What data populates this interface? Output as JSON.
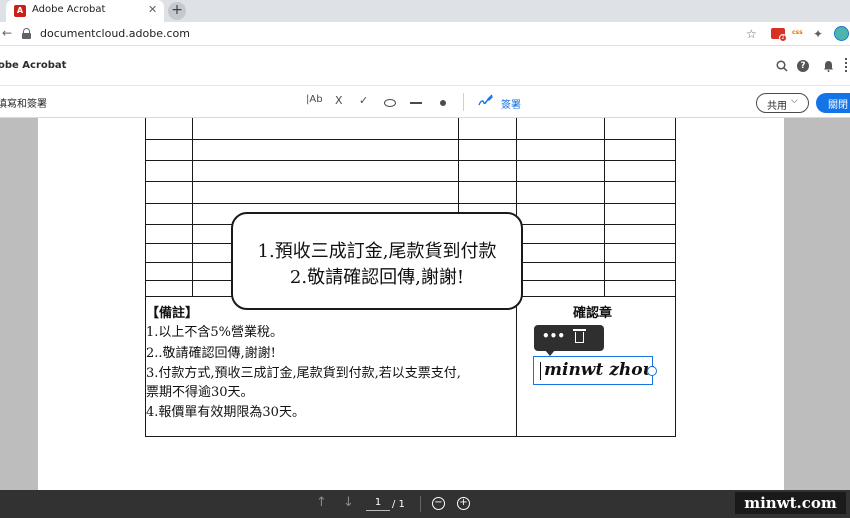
{
  "browser": {
    "tab_title": "Adobe Acrobat",
    "tab_favicon": "A",
    "tab_close": "✕",
    "new_tab": "+",
    "back": "←",
    "url": "documentcloud.adobe.com",
    "ext_badge": "2",
    "ext_css": "css"
  },
  "app": {
    "title": "obe Acrobat"
  },
  "toolbar": {
    "title": "填寫和簽署",
    "text_tool": "|Ab",
    "cross_tool": "X",
    "check_tool": "✓",
    "sign_label": "簽署",
    "share_label": "共用",
    "share_chevron": "⌵",
    "close_label": "關閉"
  },
  "document": {
    "notes_title": "【備註】",
    "notes": [
      "1.以上不含5%營業稅。",
      "2..敬請確認回傳,謝謝!",
      "3.付款方式,預收三成訂金,尾款貨到付款,若以支票支付,",
      "票期不得逾30天。",
      "4.報價單有效期限為30天。"
    ],
    "confirm_label": "確認章",
    "signature_text": "minwt zhou",
    "signature_more": "•••",
    "callout_lines": [
      "1.預收三成訂金,尾款貨到付款",
      "2.敬請確認回傳,謝謝!"
    ]
  },
  "bottombar": {
    "prev_page": "↑",
    "next_page": "↓",
    "page_current": "1",
    "page_total": "/ 1",
    "zoom_out": "−",
    "zoom_in": "+"
  },
  "watermark": "minwt.com"
}
